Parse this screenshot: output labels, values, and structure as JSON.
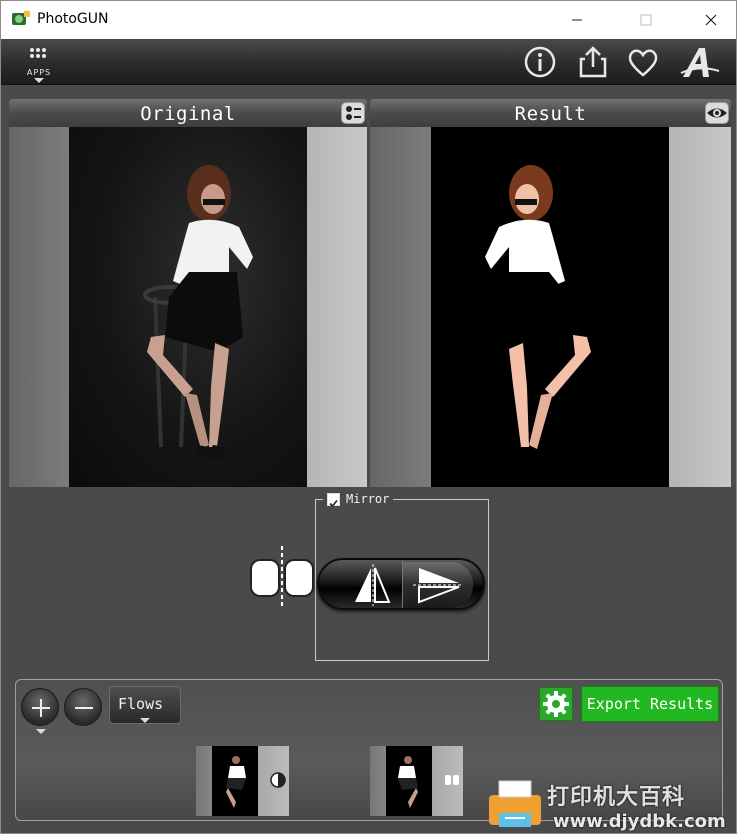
{
  "window": {
    "title": "PhotoGUN"
  },
  "toolbar": {
    "apps_label": "APPS",
    "icons": [
      "info-icon",
      "share-icon",
      "heart-icon",
      "font-a-icon"
    ]
  },
  "panels": {
    "original": {
      "title": "Original",
      "icon": "compare-icon"
    },
    "result": {
      "title": "Result",
      "icon": "eye-icon"
    }
  },
  "mirror": {
    "label": "Mirror",
    "checked": true
  },
  "flows": {
    "dropdown_label": "Flows",
    "export_label": "Export Results",
    "thumbnails": [
      "thumb-1",
      "thumb-2"
    ]
  },
  "watermark": {
    "text": "打印机大百科",
    "url": "www.djydbk.com"
  },
  "colors": {
    "accent_green": "#22b822",
    "panel_bg": "#4a4a4a"
  }
}
